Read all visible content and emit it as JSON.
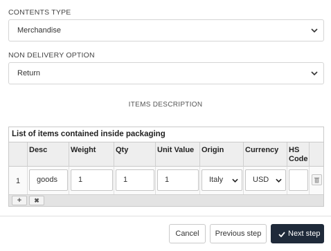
{
  "contents_type": {
    "label": "CONTENTS TYPE",
    "value": "Merchandise"
  },
  "non_delivery": {
    "label": "NON DELIVERY OPTION",
    "value": "Return"
  },
  "section_title": "ITEMS DESCRIPTION",
  "items": {
    "caption": "List of items contained inside packaging",
    "headers": {
      "desc": "Desc",
      "weight": "Weight",
      "qty": "Qty",
      "unit_value": "Unit Value",
      "origin": "Origin",
      "currency": "Currency",
      "hs_code_line1": "HS",
      "hs_code_line2": "Code"
    },
    "rows": [
      {
        "num": "1",
        "desc": "goods",
        "weight": "1",
        "qty": "1",
        "unit_value": "1",
        "origin": "Italy",
        "currency": "USD",
        "hs_code": ""
      }
    ],
    "add_label": "+",
    "remove_label": "✖"
  },
  "buttons": {
    "cancel": "Cancel",
    "previous": "Previous step",
    "next": "Next step"
  },
  "colors": {
    "primary": "#1f2a3a",
    "border": "#d4d4d4",
    "header_bg": "#eeeeee"
  }
}
